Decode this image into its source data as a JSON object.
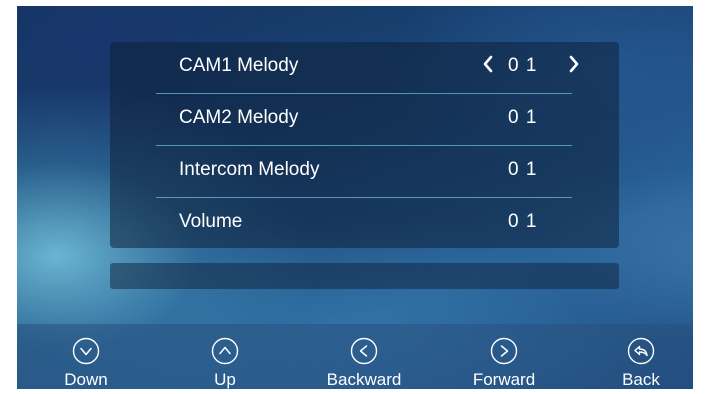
{
  "menu": {
    "items": [
      {
        "label": "CAM1 Melody",
        "value": "0 1",
        "selected": true
      },
      {
        "label": "CAM2 Melody",
        "value": "0 1",
        "selected": false
      },
      {
        "label": "Intercom Melody",
        "value": "0 1",
        "selected": false
      },
      {
        "label": "Volume",
        "value": "0 1",
        "selected": false
      }
    ]
  },
  "nav": {
    "buttons": [
      {
        "label": "Down",
        "icon": "chevron-down-icon"
      },
      {
        "label": "Up",
        "icon": "chevron-up-icon"
      },
      {
        "label": "Backward",
        "icon": "chevron-left-icon"
      },
      {
        "label": "Forward",
        "icon": "chevron-right-icon"
      },
      {
        "label": "Back",
        "icon": "return-icon"
      }
    ]
  },
  "colors": {
    "text": "#ffffff",
    "divider": "#6eb9d7",
    "panel": "#0e203a"
  }
}
